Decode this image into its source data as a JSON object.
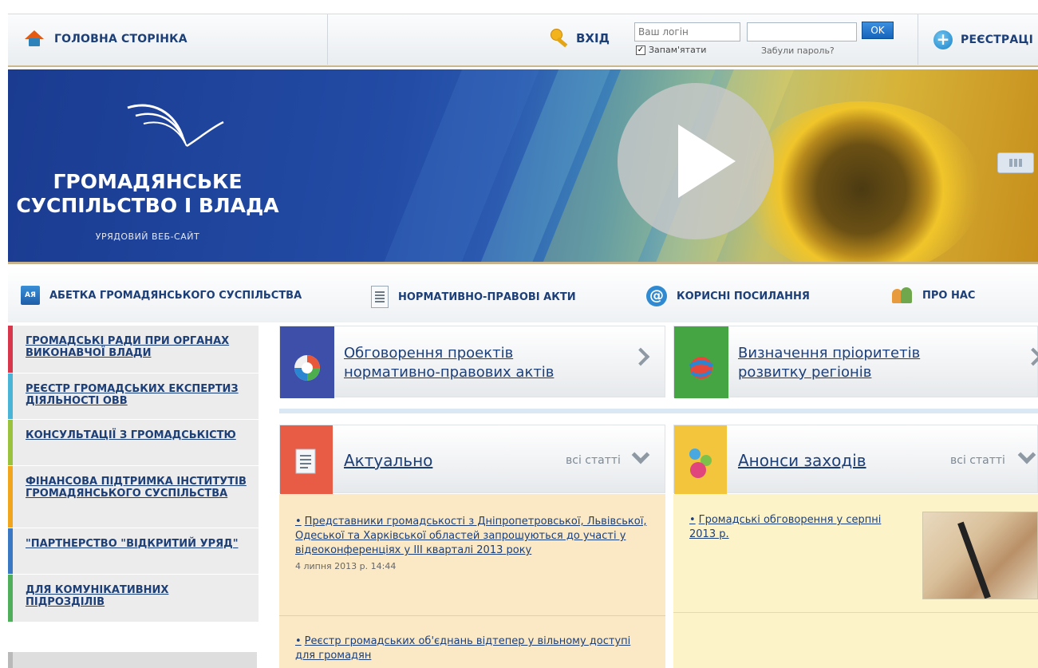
{
  "header": {
    "home_label": "ГОЛОВНА СТОРІНКА",
    "login_label": "ВХІД",
    "login_placeholder": "Ваш логін",
    "ok_label": "OK",
    "remember_label": "Запам'ятати",
    "forgot_label": "Забули пароль?",
    "register_label": "РЕЄСТРАЦІ"
  },
  "banner": {
    "title_line1": "ГРОМАДЯНСЬКЕ",
    "title_line2": "СУСПІЛЬСТВО І ВЛАДА",
    "subtitle": "УРЯДОВИЙ ВЕБ-САЙТ"
  },
  "nav": {
    "items": [
      {
        "label": "АБЕТКА ГРОМАДЯНСЬКОГО СУСПІЛЬСТВА",
        "icon": "abc-book-icon",
        "icon_text": "АЯ"
      },
      {
        "label": "НОРМАТИВНО-ПРАВОВІ АКТИ",
        "icon": "document-icon"
      },
      {
        "label": "КОРИСНІ ПОСИЛАННЯ",
        "icon": "at-icon",
        "icon_text": "@"
      },
      {
        "label": "ПРО НАС",
        "icon": "people-icon"
      }
    ]
  },
  "sidebar": {
    "items": [
      {
        "label": "ГРОМАДСЬКІ РАДИ ПРИ ОРГАНАХ ВИКОНАВЧОЇ ВЛАДИ",
        "color": "#d8364a"
      },
      {
        "label": "РЕЄСТР ГРОМАДСЬКИХ ЕКСПЕРТИЗ ДІЯЛЬНОСТІ ОВВ",
        "color": "#4ab4d6"
      },
      {
        "label": "КОНСУЛЬТАЦІЇ З ГРОМАДСЬКІСТЮ",
        "color": "#9ac23c"
      },
      {
        "label": "ФІНАНСОВА ПІДТРИМКА ІНСТИТУТІВ ГРОМАДЯНСЬКОГО СУСПІЛЬСТВА",
        "color": "#f0a51d"
      },
      {
        "label": "\"ПАРТНЕРСТВО \"ВІДКРИТИЙ УРЯД\"",
        "color": "#3a78c4"
      },
      {
        "label": "ДЛЯ КОМУНІКАТИВНИХ ПІДРОЗДІЛІВ",
        "color": "#4fae5a"
      }
    ]
  },
  "tiles": [
    {
      "line1": "Обговорення проектів",
      "line2": "нормативно-правових актів",
      "color": "#3d4fa8"
    },
    {
      "line1": "Визначення пріоритетів",
      "line2": "розвитку регіонів",
      "color": "#46a543"
    }
  ],
  "sections": {
    "actual": {
      "title": "Актуально",
      "all_label": "всі статті",
      "color": "#e85c45",
      "bg": "#fbe9c5"
    },
    "events": {
      "title": "Анонси заходів",
      "all_label": "всі статті",
      "color": "#f2c53d",
      "bg": "#fdf3c9"
    }
  },
  "news": [
    {
      "title": "Представники громадськості з Дніпропетровської, Львівської, Одеської та Харківської областей запрошуються до участі у відеоконференціях у ІІІ кварталі 2013 року",
      "date": "4 липня 2013 р. 14:44"
    },
    {
      "title": "Реєстр громадських об'єднань відтепер у вільному доступі для громадян",
      "date": ""
    }
  ],
  "events": [
    {
      "title": "Громадські обговорення у серпні 2013 р."
    }
  ]
}
